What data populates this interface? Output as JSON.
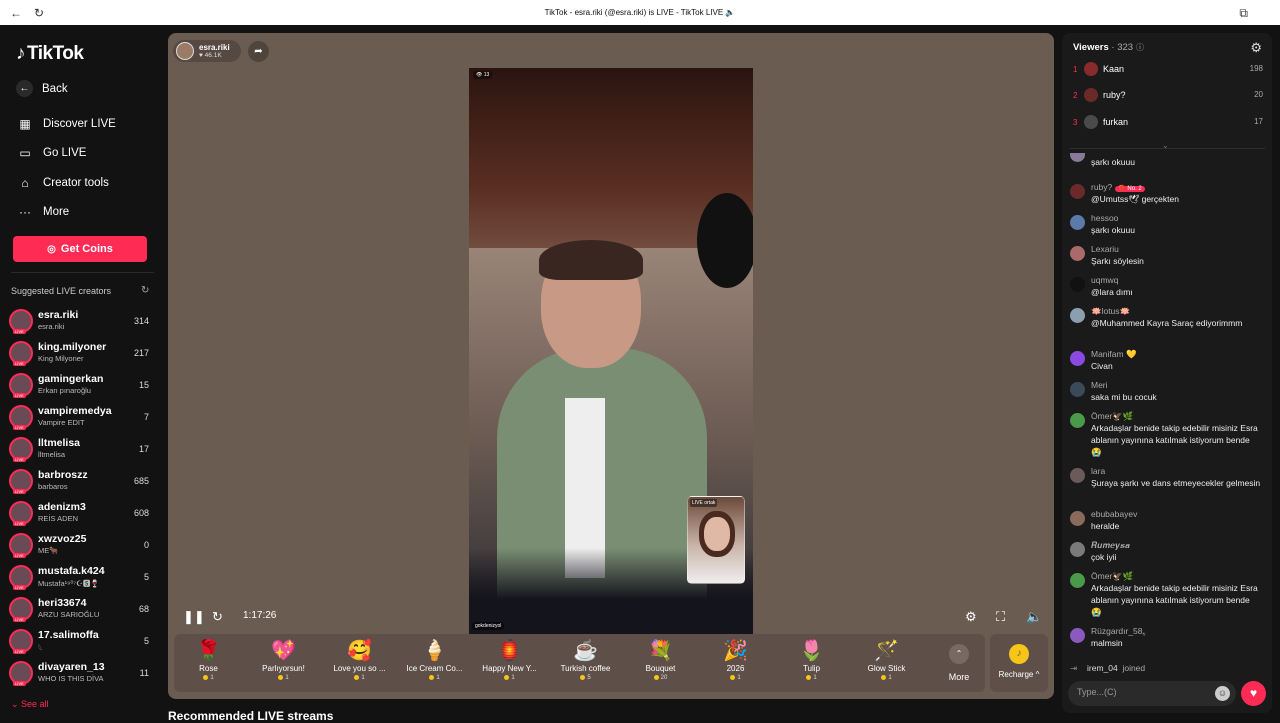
{
  "browser": {
    "title": "TikTok - esra.riki (@esra.riki) is LIVE - TikTok LIVE 🔈"
  },
  "sidebar": {
    "logo": "TikTok",
    "back": "Back",
    "nav": [
      "Discover LIVE",
      "Go LIVE",
      "Creator tools",
      "More"
    ],
    "get_coins": "Get Coins",
    "suggested_header": "Suggested LIVE creators",
    "creators": [
      {
        "name": "esra.riki",
        "sub": "esra.riki",
        "count": "314"
      },
      {
        "name": "king.milyoner",
        "sub": "King Milyoner",
        "count": "217"
      },
      {
        "name": "gamingerkan",
        "sub": "Erkan pınaroğlu",
        "count": "15"
      },
      {
        "name": "vampiremedya",
        "sub": "Vampire EDIT",
        "count": "7"
      },
      {
        "name": "lltmelisa",
        "sub": "lltmelisa",
        "count": "17"
      },
      {
        "name": "barbroszz",
        "sub": "barbaros",
        "count": "685"
      },
      {
        "name": "adenizm3",
        "sub": "REİS ADEN",
        "count": "608"
      },
      {
        "name": "xwzvoz25",
        "sub": "ME🐂",
        "count": "0"
      },
      {
        "name": "mustafa.k424",
        "sub": "Mustafa¹⁹⁰⁷☪︎🆂🍷",
        "count": "5"
      },
      {
        "name": "heri33674",
        "sub": "ARZU SARIOĞLU",
        "count": "68"
      },
      {
        "name": "17.salimoffa",
        "sub": "𓆩",
        "count": "5"
      },
      {
        "name": "divayaren_13",
        "sub": "WHO IS THIS DİVA",
        "count": "11"
      }
    ],
    "live_badge": "LIVE",
    "see_all": "See all"
  },
  "stream": {
    "host_name": "esra.riki",
    "host_likes": "♥ 46.1K",
    "badge": "👁 13",
    "tag": "gokdenizyol",
    "pip_label": "LIVE ortak",
    "time": "1:17:26",
    "gifts": [
      {
        "name": "Rose",
        "price": "1",
        "icon": "🌹"
      },
      {
        "name": "Parlıyorsun!",
        "price": "1",
        "icon": "💖"
      },
      {
        "name": "Love you so ...",
        "price": "1",
        "icon": "🥰"
      },
      {
        "name": "Ice Cream Co...",
        "price": "1",
        "icon": "🍦"
      },
      {
        "name": "Happy New Y...",
        "price": "1",
        "icon": "🏮"
      },
      {
        "name": "Turkish coffee",
        "price": "5",
        "icon": "☕"
      },
      {
        "name": "Bouquet",
        "price": "20",
        "icon": "💐"
      },
      {
        "name": "2026",
        "price": "1",
        "icon": "🎉"
      },
      {
        "name": "Tulip",
        "price": "1",
        "icon": "🌷"
      },
      {
        "name": "Glow Stick",
        "price": "1",
        "icon": "🪄"
      }
    ],
    "more": "More",
    "recharge": "Recharge ^"
  },
  "recommended": "Recommended LIVE streams",
  "viewers": {
    "label": "Viewers",
    "count": "· 323",
    "top": [
      {
        "rank": "1",
        "name": "Kaan",
        "count": "198"
      },
      {
        "rank": "2",
        "name": "ruby?",
        "count": "20"
      },
      {
        "rank": "3",
        "name": "furkan",
        "count": "17"
      }
    ]
  },
  "chat": [
    {
      "name": "hessoo",
      "text": "şarkı okuuu",
      "color": "#8a7a9a"
    },
    {
      "name": "ruby?",
      "badge": "🔴 No. 2",
      "text": "@Umutss🕊 gerçekten",
      "color": "#6a2a2a"
    },
    {
      "name": "hessoo",
      "text": "şarkı okuuu",
      "color": "#5a7aaa"
    },
    {
      "name": "Lexariu",
      "text": "Şarkı söylesin",
      "color": "#aa6a6a"
    },
    {
      "name": "uqmwq",
      "text": "@lara dımı",
      "color": "#111111"
    },
    {
      "name": "🪷lotus🪷",
      "text": "@Muhammed Kayra Saraç ediyorimmm",
      "color": "#8aa0b0"
    },
    {
      "name": "Manifam 💛",
      "text": "Civan",
      "color": "#8a4ae0"
    },
    {
      "name": "Meri",
      "text": "saka mi bu cocuk",
      "color": "#3a4a5a"
    },
    {
      "name": "Ömer🦅🌿",
      "text": "Arkadaşlar benide takip edebilir misiniz Esra ablanın yayınına katılmak istiyorum bende 😭",
      "color": "#4a9a4a"
    },
    {
      "name": "lara",
      "text": "Şuraya şarkı ve dans etmeyecekler gelmesin",
      "color": "#6a5a5a"
    },
    {
      "name": "ebubabayev",
      "text": "heralde",
      "color": "#8a6a5a"
    },
    {
      "name": "𝑹𝒖𝒎𝒆𝒚𝒔𝒂",
      "text": "çok iyii",
      "color": "#7a7a7a"
    },
    {
      "name": "Ömer🦅🌿",
      "text": "Arkadaşlar benide takip edebilir misiniz Esra ablanın yayınına katılmak istiyorum bende 😭",
      "color": "#4a9a4a"
    },
    {
      "name": "Rüzgardır_58ﮩ",
      "text": "malmsin",
      "color": "#8a5ac0"
    }
  ],
  "joined": {
    "user": "irem_04",
    "text": "joined"
  },
  "input": {
    "placeholder": "Type...(C)"
  }
}
